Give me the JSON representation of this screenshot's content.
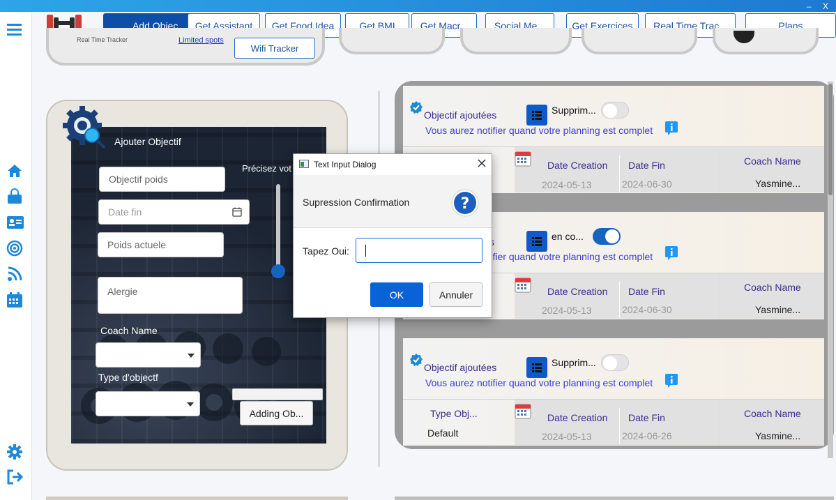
{
  "window": {
    "close_label": "X",
    "minimize_label": "_"
  },
  "nav": {
    "items": [
      {
        "label": "Add Objec..."
      },
      {
        "label": "Get Assistant"
      },
      {
        "label": "Get Food Idea"
      },
      {
        "label": "Get BMI"
      },
      {
        "label": "Get Macr..."
      },
      {
        "label": "Social Me..."
      },
      {
        "label": "Get Exercices"
      },
      {
        "label": "Real Time Trac..."
      },
      {
        "label": "Plans"
      }
    ]
  },
  "top_strip": {
    "tracker_text": "Real Time Tracker",
    "spots_link": "Limited spots",
    "tracker_button": "Wifi Tracker"
  },
  "form": {
    "title": "Ajouter Objectif",
    "objectif_placeholder": "Objectif  poids",
    "date_fin_placeholder": "Date fin",
    "poids_placeholder": "Poids actuele",
    "alergie_placeholder": "Alergie",
    "precisez_label": "Précisez vot",
    "coach_label": "Coach Name",
    "type_label": "Type d'objectf",
    "adding_button": "Adding Ob..."
  },
  "cards": [
    {
      "title": "Objectif ajoutées",
      "toggle_label": "Supprim...",
      "toggle_on": false,
      "notice": "Vous aurez notifier quand votre planning est complet",
      "type_label": "",
      "type_value": "",
      "date_creation_label": "Date Creation",
      "date_creation": "2024-05-13",
      "date_fin_label": "Date Fin",
      "date_fin": "2024-06-30",
      "coach_label": "Coach Name",
      "coach": "Yasmine..."
    },
    {
      "title": "s",
      "toggle_label": "en co...",
      "toggle_on": true,
      "notice": "Vous aurez notifier quand votre planning est complet",
      "type_label": "",
      "type_value": "",
      "date_creation_label": "Date Creation",
      "date_creation": "2024-05-13",
      "date_fin_label": "Date Fin",
      "date_fin": "2024-06-30",
      "coach_label": "Coach Name",
      "coach": "Yasmine..."
    },
    {
      "title": "Objectif ajoutées",
      "toggle_label": "Supprim...",
      "toggle_on": false,
      "notice": "Vous aurez notifier quand votre planning est complet",
      "type_label": "Type Obj...",
      "type_value": "Default",
      "date_creation_label": "Date Creation",
      "date_creation": "2024-05-13",
      "date_fin_label": "Date Fin",
      "date_fin": "2024-06-26",
      "coach_label": "Coach Name",
      "coach": "Yasmine..."
    }
  ],
  "dialog": {
    "title": "Text Input Dialog",
    "header": "Supression Confirmation",
    "prompt_label": "Tapez Oui:",
    "input_value": "",
    "ok_label": "OK",
    "cancel_label": "Annuler"
  },
  "colors": {
    "accent": "#0d4ea8",
    "title_gradient_start": "#2da5e8",
    "title_gradient_end": "#1e7ad2",
    "toggle_on": "#1565c0",
    "dialog_ok": "#0a63d6"
  },
  "icons": [
    "menu-icon",
    "dumbbell-logo-icon",
    "home-icon",
    "shopping-bag-icon",
    "id-card-icon",
    "target-icon",
    "rss-icon",
    "calendar-icon",
    "settings-icon",
    "logout-icon",
    "gear-search-icon",
    "calendar-small-icon",
    "list-icon",
    "info-icon",
    "verified-badge-icon",
    "question-icon",
    "chevron-down-icon"
  ]
}
